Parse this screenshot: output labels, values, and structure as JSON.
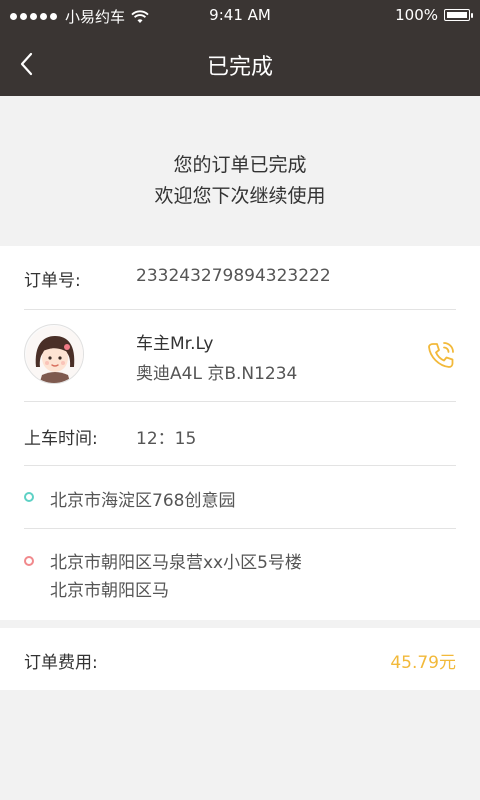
{
  "status_bar": {
    "carrier": "小易约车",
    "time": "9:41 AM",
    "battery": "100%"
  },
  "nav": {
    "title": "已完成",
    "back_icon": "chevron-left-icon"
  },
  "message": {
    "line1": "您的订单已完成",
    "line2": "欢迎您下次继续使用"
  },
  "order": {
    "label": "订单号:",
    "number": "233243279894323222"
  },
  "driver": {
    "name": "车主Mr.Ly",
    "car": "奥迪A4L  京B.N1234",
    "avatar_icon": "driver-avatar",
    "phone_icon": "phone-icon",
    "phone_color": "#f2b93a"
  },
  "pickup_time": {
    "label": "上车时间:",
    "value": "12：15"
  },
  "route": {
    "from": "北京市海淀区768创意园",
    "to_line1": "北京市朝阳区马泉营xx小区5号楼",
    "to_line2": "北京市朝阳区马",
    "from_color": "#5ed1c5",
    "to_color": "#f1898c"
  },
  "fee": {
    "label": "订单费用:",
    "value": "45.79元",
    "color": "#f2b93a"
  },
  "colors": {
    "header_bg": "#3a3533",
    "page_bg": "#f2f2f2"
  }
}
